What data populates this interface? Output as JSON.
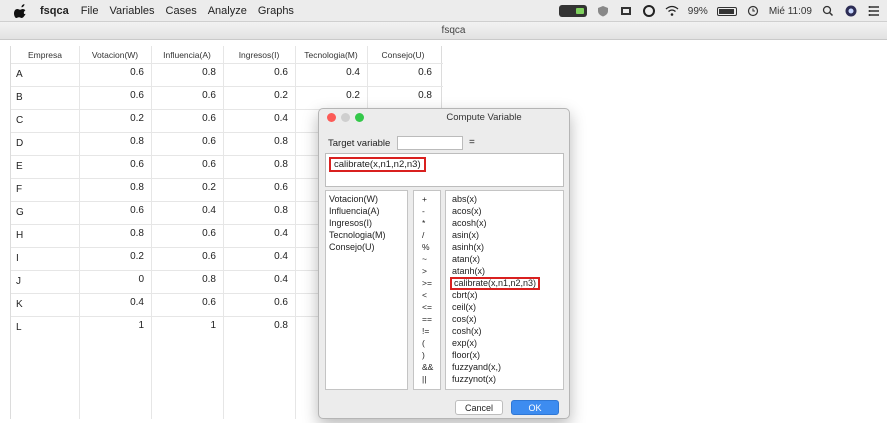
{
  "menubar": {
    "app_name": "fsqca",
    "menus": [
      "File",
      "Variables",
      "Cases",
      "Analyze",
      "Graphs"
    ],
    "status": {
      "battery": "99%",
      "clock": "Mié 11:09"
    }
  },
  "window": {
    "title": "fsqca"
  },
  "grid": {
    "columns": [
      "Empresa",
      "Votacion(W)",
      "Influencia(A)",
      "Ingresos(I)",
      "Tecnologia(M)",
      "Consejo(U)"
    ],
    "rows": [
      {
        "name": "A",
        "values": [
          "0.6",
          "0.8",
          "0.6",
          "0.4",
          "0.6"
        ]
      },
      {
        "name": "B",
        "values": [
          "0.6",
          "0.6",
          "0.2",
          "0.2",
          "0.8"
        ]
      },
      {
        "name": "C",
        "values": [
          "0.2",
          "0.6",
          "0.4",
          "",
          ""
        ]
      },
      {
        "name": "D",
        "values": [
          "0.8",
          "0.6",
          "0.8",
          "",
          ""
        ]
      },
      {
        "name": "E",
        "values": [
          "0.6",
          "0.6",
          "0.8",
          "",
          ""
        ]
      },
      {
        "name": "F",
        "values": [
          "0.8",
          "0.2",
          "0.6",
          "",
          ""
        ]
      },
      {
        "name": "G",
        "values": [
          "0.6",
          "0.4",
          "0.8",
          "",
          ""
        ]
      },
      {
        "name": "H",
        "values": [
          "0.8",
          "0.6",
          "0.4",
          "",
          ""
        ]
      },
      {
        "name": "I",
        "values": [
          "0.2",
          "0.6",
          "0.4",
          "",
          ""
        ]
      },
      {
        "name": "J",
        "values": [
          "0",
          "0.8",
          "0.4",
          "",
          ""
        ]
      },
      {
        "name": "K",
        "values": [
          "0.4",
          "0.6",
          "0.6",
          "",
          ""
        ]
      },
      {
        "name": "L",
        "values": [
          "1",
          "1",
          "0.8",
          "",
          ""
        ]
      }
    ]
  },
  "dialog": {
    "title": "Compute Variable",
    "target_label": "Target variable",
    "target_value": "",
    "equals": "=",
    "expression": "calibrate(x,n1,n2,n3)",
    "variables": [
      "Votacion(W)",
      "Influencia(A)",
      "Ingresos(I)",
      "Tecnologia(M)",
      "Consejo(U)"
    ],
    "operators": [
      "+",
      "-",
      "*",
      "/",
      "%",
      "~",
      ">",
      ">=",
      "<",
      "<=",
      "==",
      "!=",
      "(",
      ")",
      "&&",
      "||"
    ],
    "functions": [
      "abs(x)",
      "acos(x)",
      "acosh(x)",
      "asin(x)",
      "asinh(x)",
      "atan(x)",
      "atanh(x)",
      "calibrate(x,n1,n2,n3)",
      "cbrt(x)",
      "ceil(x)",
      "cos(x)",
      "cosh(x)",
      "exp(x)",
      "floor(x)",
      "fuzzyand(x,)",
      "fuzzynot(x)"
    ],
    "highlighted_function": "calibrate(x,n1,n2,n3)",
    "cancel_label": "Cancel",
    "ok_label": "OK"
  },
  "colors": {
    "highlight_border": "#d9201f",
    "ok_button": "#3d8cf0"
  }
}
